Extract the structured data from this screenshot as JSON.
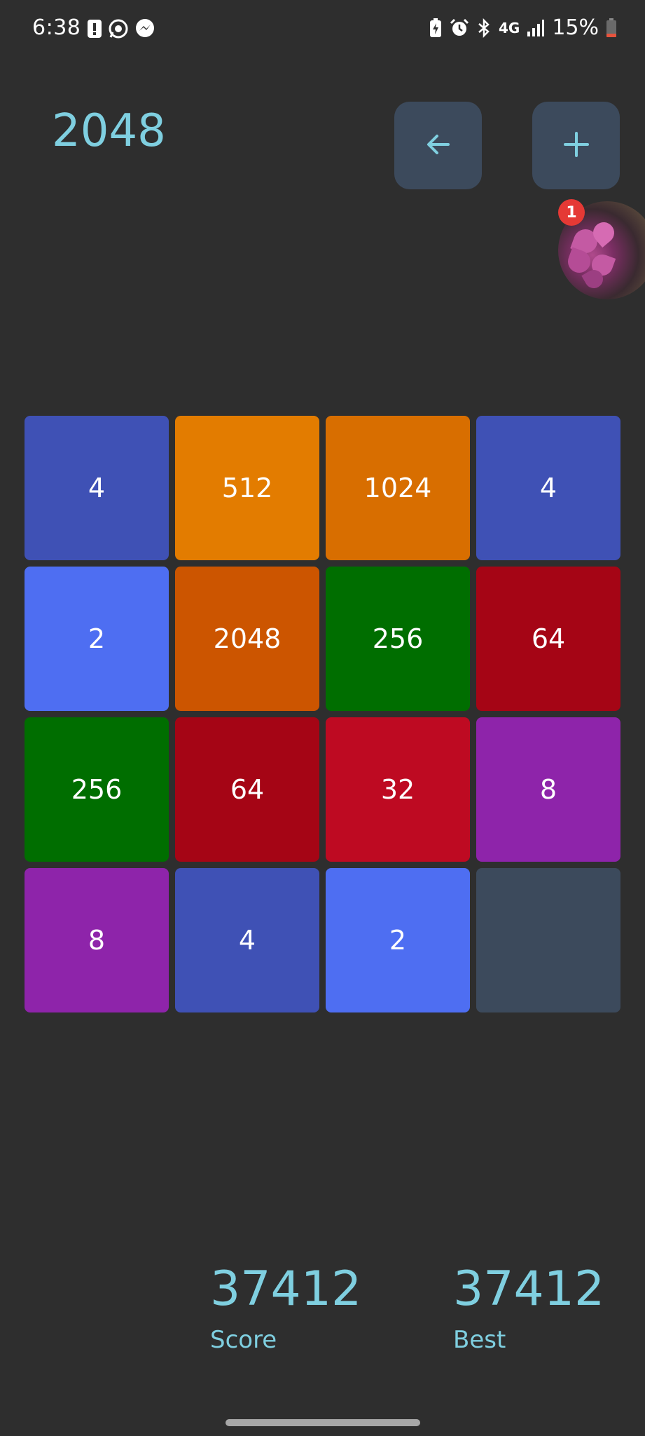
{
  "status_bar": {
    "time": "6:38",
    "network": "4G",
    "battery": "15%",
    "left_icons": [
      "alert-icon",
      "whatsapp-icon",
      "messenger-icon"
    ],
    "right_icons": [
      "battery-saver-icon",
      "alarm-icon",
      "bluetooth-icon",
      "lte-icon",
      "signal-icon",
      "battery-icon"
    ]
  },
  "header": {
    "title": "2048",
    "undo_icon": "arrow-left-icon",
    "new_game_icon": "plus-icon"
  },
  "chat_head": {
    "badge_count": "1"
  },
  "board": {
    "size": 4,
    "empty_color": "#3c4a5c",
    "rows": [
      [
        {
          "value": "4",
          "color": "#3f51b5"
        },
        {
          "value": "512",
          "color": "#e37c00"
        },
        {
          "value": "1024",
          "color": "#d86e00"
        },
        {
          "value": "4",
          "color": "#3f51b5"
        }
      ],
      [
        {
          "value": "2",
          "color": "#4e6ef2"
        },
        {
          "value": "2048",
          "color": "#cc5500"
        },
        {
          "value": "256",
          "color": "#006e00"
        },
        {
          "value": "64",
          "color": "#a50515"
        }
      ],
      [
        {
          "value": "256",
          "color": "#006e00"
        },
        {
          "value": "64",
          "color": "#a50515"
        },
        {
          "value": "32",
          "color": "#be0a22"
        },
        {
          "value": "8",
          "color": "#8e24aa"
        }
      ],
      [
        {
          "value": "8",
          "color": "#8e24aa"
        },
        {
          "value": "4",
          "color": "#3f51b5"
        },
        {
          "value": "2",
          "color": "#4e6ef2"
        },
        {
          "value": "",
          "color": "#3c4a5c"
        }
      ]
    ]
  },
  "scores": {
    "score_value": "37412",
    "score_label": "Score",
    "best_value": "37412",
    "best_label": "Best"
  },
  "colors": {
    "background": "#2e2e2e",
    "accent": "#7fcfe0",
    "button_bg": "#3c4a5c"
  }
}
